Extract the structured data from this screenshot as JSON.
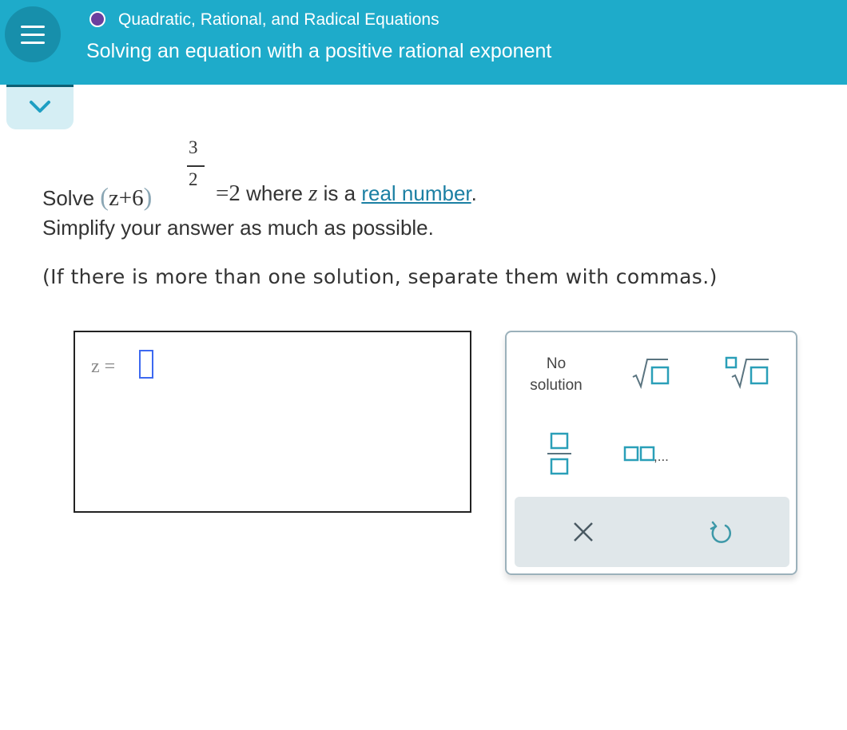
{
  "header": {
    "topic": "Quadratic, Rational, and Radical Equations",
    "title": "Solving an equation with a positive rational exponent",
    "colors": {
      "background": "#1eabca",
      "topic_dot": "#6a3f9e"
    }
  },
  "problem": {
    "solve_word": "Solve",
    "base": "z+6",
    "exponent_numerator": "3",
    "exponent_denominator": "2",
    "rhs": "=2",
    "where_text": " where ",
    "variable": "z",
    "is_a_text": " is a ",
    "link_text": "real number",
    "period": ".",
    "simplify_text": "Simplify your answer as much as possible.",
    "note_text": "(If there is more than one solution, separate them with commas.)"
  },
  "answer": {
    "label": "z =",
    "value": ""
  },
  "keypad": {
    "no_solution_line1": "No",
    "no_solution_line2": "solution",
    "keys": [
      "No solution",
      "square-root-icon",
      "nth-root-icon",
      "fraction-icon",
      "list-icon",
      "clear-icon",
      "undo-icon"
    ],
    "list_suffix": ",..."
  }
}
